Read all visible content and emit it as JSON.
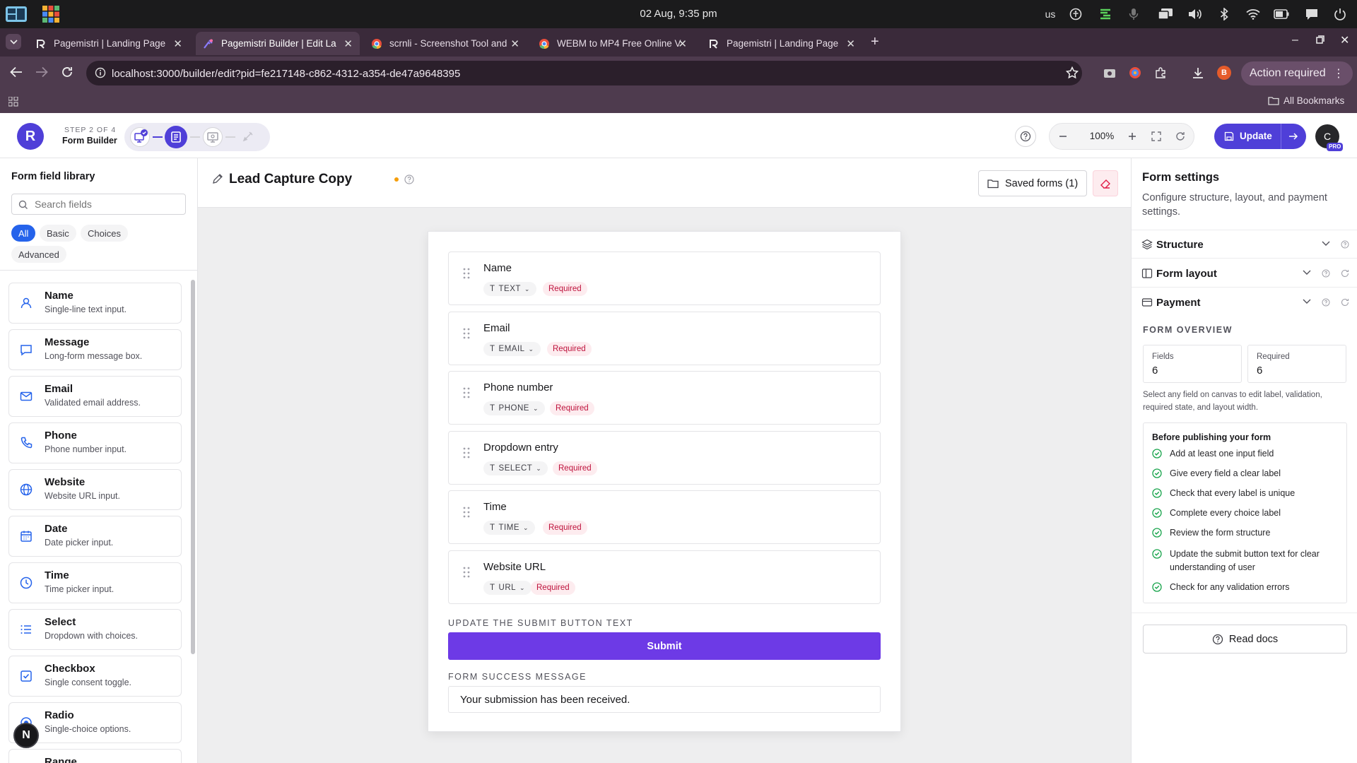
{
  "os": {
    "clock": "02 Aug, 9:35 pm",
    "keyboard": "us"
  },
  "browser": {
    "tabs": [
      {
        "title": "Pagemistri | Landing Page",
        "active": false
      },
      {
        "title": "Pagemistri Builder | Edit La",
        "active": true
      },
      {
        "title": "scrnli - Screenshot Tool and",
        "active": false
      },
      {
        "title": "WEBM to MP4 Free Online V",
        "active": false
      },
      {
        "title": "Pagemistri | Landing Page",
        "active": false
      }
    ],
    "url": "localhost:3000/builder/edit?pid=fe217148-c862-4312-a354-de47a9648395",
    "profile_badge": "B",
    "action_required": "Action required",
    "all_bookmarks": "All Bookmarks"
  },
  "header": {
    "logo_letter": "R",
    "step_label": "STEP 2 OF 4",
    "step_name": "Form Builder",
    "zoom": "100%",
    "update_label": "Update",
    "avatar_letter": "C",
    "pro_badge": "PRO"
  },
  "library": {
    "title": "Form field library",
    "search_placeholder": "Search fields",
    "filters": [
      "All",
      "Basic",
      "Choices",
      "Advanced"
    ],
    "active_filter": "All",
    "fields": [
      {
        "name": "Name",
        "desc": "Single-line text input.",
        "icon": "user-icon"
      },
      {
        "name": "Message",
        "desc": "Long-form message box.",
        "icon": "message-icon"
      },
      {
        "name": "Email",
        "desc": "Validated email address.",
        "icon": "mail-icon"
      },
      {
        "name": "Phone",
        "desc": "Phone number input.",
        "icon": "phone-icon"
      },
      {
        "name": "Website",
        "desc": "Website URL input.",
        "icon": "globe-icon"
      },
      {
        "name": "Date",
        "desc": "Date picker input.",
        "icon": "calendar-icon"
      },
      {
        "name": "Time",
        "desc": "Time picker input.",
        "icon": "clock-icon"
      },
      {
        "name": "Select",
        "desc": "Dropdown with choices.",
        "icon": "list-icon"
      },
      {
        "name": "Checkbox",
        "desc": "Single consent toggle.",
        "icon": "checkbox-icon"
      },
      {
        "name": "Radio",
        "desc": "Single-choice options.",
        "icon": "radio-icon"
      },
      {
        "name": "Range",
        "desc": "",
        "icon": "range-icon"
      }
    ],
    "floating_badge": "N"
  },
  "canvas": {
    "form_title": "Lead Capture Copy",
    "saved_forms": "Saved forms (1)",
    "fields": [
      {
        "label": "Name",
        "type": "TEXT",
        "required": "Required"
      },
      {
        "label": "Email",
        "type": "EMAIL",
        "required": "Required"
      },
      {
        "label": "Phone number",
        "type": "PHONE",
        "required": "Required"
      },
      {
        "label": "Dropdown entry",
        "type": "SELECT",
        "required": "Required"
      },
      {
        "label": "Time",
        "type": "TIME",
        "required": "Required"
      },
      {
        "label": "Website URL",
        "type": "URL",
        "required": "Required"
      }
    ],
    "submit_section_label": "UPDATE THE SUBMIT BUTTON TEXT",
    "submit_label": "Submit",
    "success_section_label": "FORM SUCCESS MESSAGE",
    "success_message": "Your submission has been received."
  },
  "settings": {
    "title": "Form settings",
    "subtitle": "Configure structure, layout, and payment settings.",
    "sections": [
      "Structure",
      "Form layout",
      "Payment"
    ],
    "overview_title": "FORM OVERVIEW",
    "stats": [
      {
        "label": "Fields",
        "value": "6"
      },
      {
        "label": "Required",
        "value": "6"
      }
    ],
    "hint": "Select any field on canvas to edit label, validation, required state, and layout width.",
    "checklist_title": "Before publishing your form",
    "checklist": [
      "Add at least one input field",
      "Give every field a clear label",
      "Check that every label is unique",
      "Complete every choice label",
      "Review the form structure",
      "Update the submit button text for clear understanding of user",
      "Check for any validation errors"
    ],
    "read_docs": "Read docs"
  },
  "colors": {
    "accent": "#4f3fd8",
    "submit": "#6d3ae6",
    "required": "#be123c",
    "check": "#16a34a",
    "blue": "#2563eb"
  }
}
